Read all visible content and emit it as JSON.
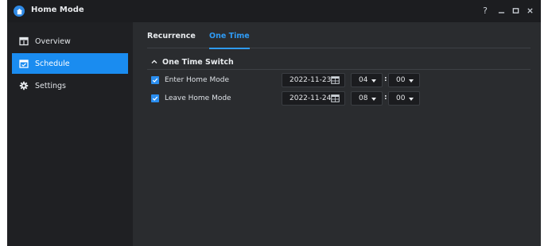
{
  "window": {
    "title": "Home Mode",
    "controls": [
      {
        "name": "help-icon",
        "glyph": "?"
      },
      {
        "name": "minimize-icon",
        "glyph": "–"
      },
      {
        "name": "maximize-icon",
        "glyph": "▫"
      },
      {
        "name": "close-icon",
        "glyph": "✕"
      }
    ]
  },
  "sidebar": {
    "items": [
      {
        "label": "Overview",
        "icon": "overview-icon",
        "active": false
      },
      {
        "label": "Schedule",
        "icon": "calendar-check-icon",
        "active": true
      },
      {
        "label": "Settings",
        "icon": "gear-icon",
        "active": false
      }
    ]
  },
  "tabs": [
    {
      "label": "Recurrence",
      "active": false
    },
    {
      "label": "One Time",
      "active": true
    }
  ],
  "section": {
    "title": "One Time Switch",
    "rows": [
      {
        "checked": true,
        "label": "Enter Home Mode",
        "date": "2022-11-23",
        "hour": "04",
        "minute": "00"
      },
      {
        "checked": true,
        "label": "Leave Home Mode",
        "date": "2022-11-24",
        "hour": "08",
        "minute": "00"
      }
    ]
  },
  "colors": {
    "accent": "#1a8cf0",
    "tab_active": "#2f9bf5",
    "background": "#2a2c2f",
    "sidebar": "#1f2023"
  }
}
